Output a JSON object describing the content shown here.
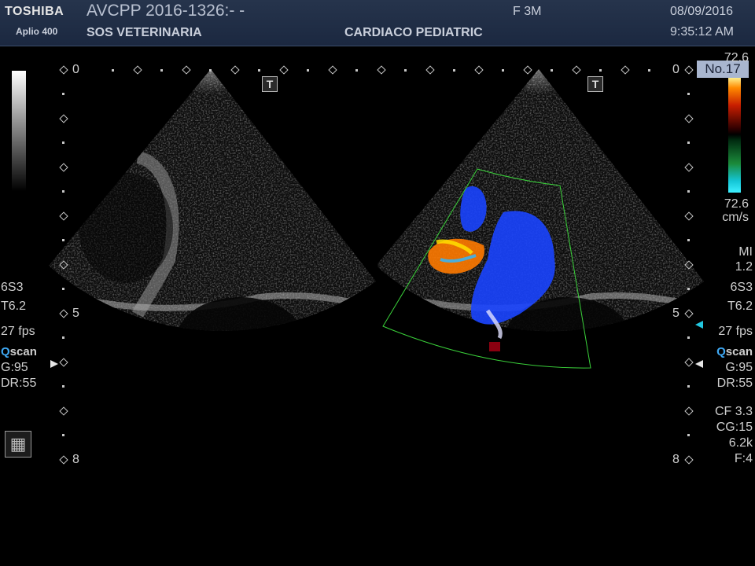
{
  "header": {
    "brand": "TOSHIBA",
    "model": "Aplio 400",
    "patient_id": "AVCPP 2016-1326:- -",
    "institution": "SOS VETERINARIA",
    "sex_age": "F  3M",
    "exam": "CARDIACO PEDIATRIC",
    "date": "08/09/2016",
    "time": "9:35:12 AM"
  },
  "image_number": "No.17",
  "velocity_scale": {
    "top": "72.6",
    "bottom": "72.6",
    "unit": "cm/s"
  },
  "depth_scale": {
    "top": "0",
    "mid": "5",
    "bottom": "8"
  },
  "left_panel": {
    "probe": "6S3",
    "tis": "T6.2",
    "fps": "27 fps",
    "qscan_q": "Q",
    "qscan_rest": "scan",
    "gain": "G:95",
    "dynamic_range": "DR:55"
  },
  "right_panel": {
    "mi_label": "MI",
    "mi_value": "1.2",
    "probe": "6S3",
    "tis": "T6.2",
    "fps": "27 fps",
    "qscan_q": "Q",
    "qscan_rest": "scan",
    "gain": "G:95",
    "dynamic_range": "DR:55",
    "cf": "CF 3.3",
    "cg": "CG:15",
    "prf": "6.2k",
    "filter": "F:4"
  },
  "icons": {
    "film": "film-icon",
    "t_marker": "t-marker-icon",
    "focus": "focus-arrow-icon"
  },
  "colors": {
    "header_bg": "#1b2840",
    "color_box": "#3ad13a",
    "qscan_accent": "#3fa9f5",
    "focus_marker": "#22c7e0"
  }
}
